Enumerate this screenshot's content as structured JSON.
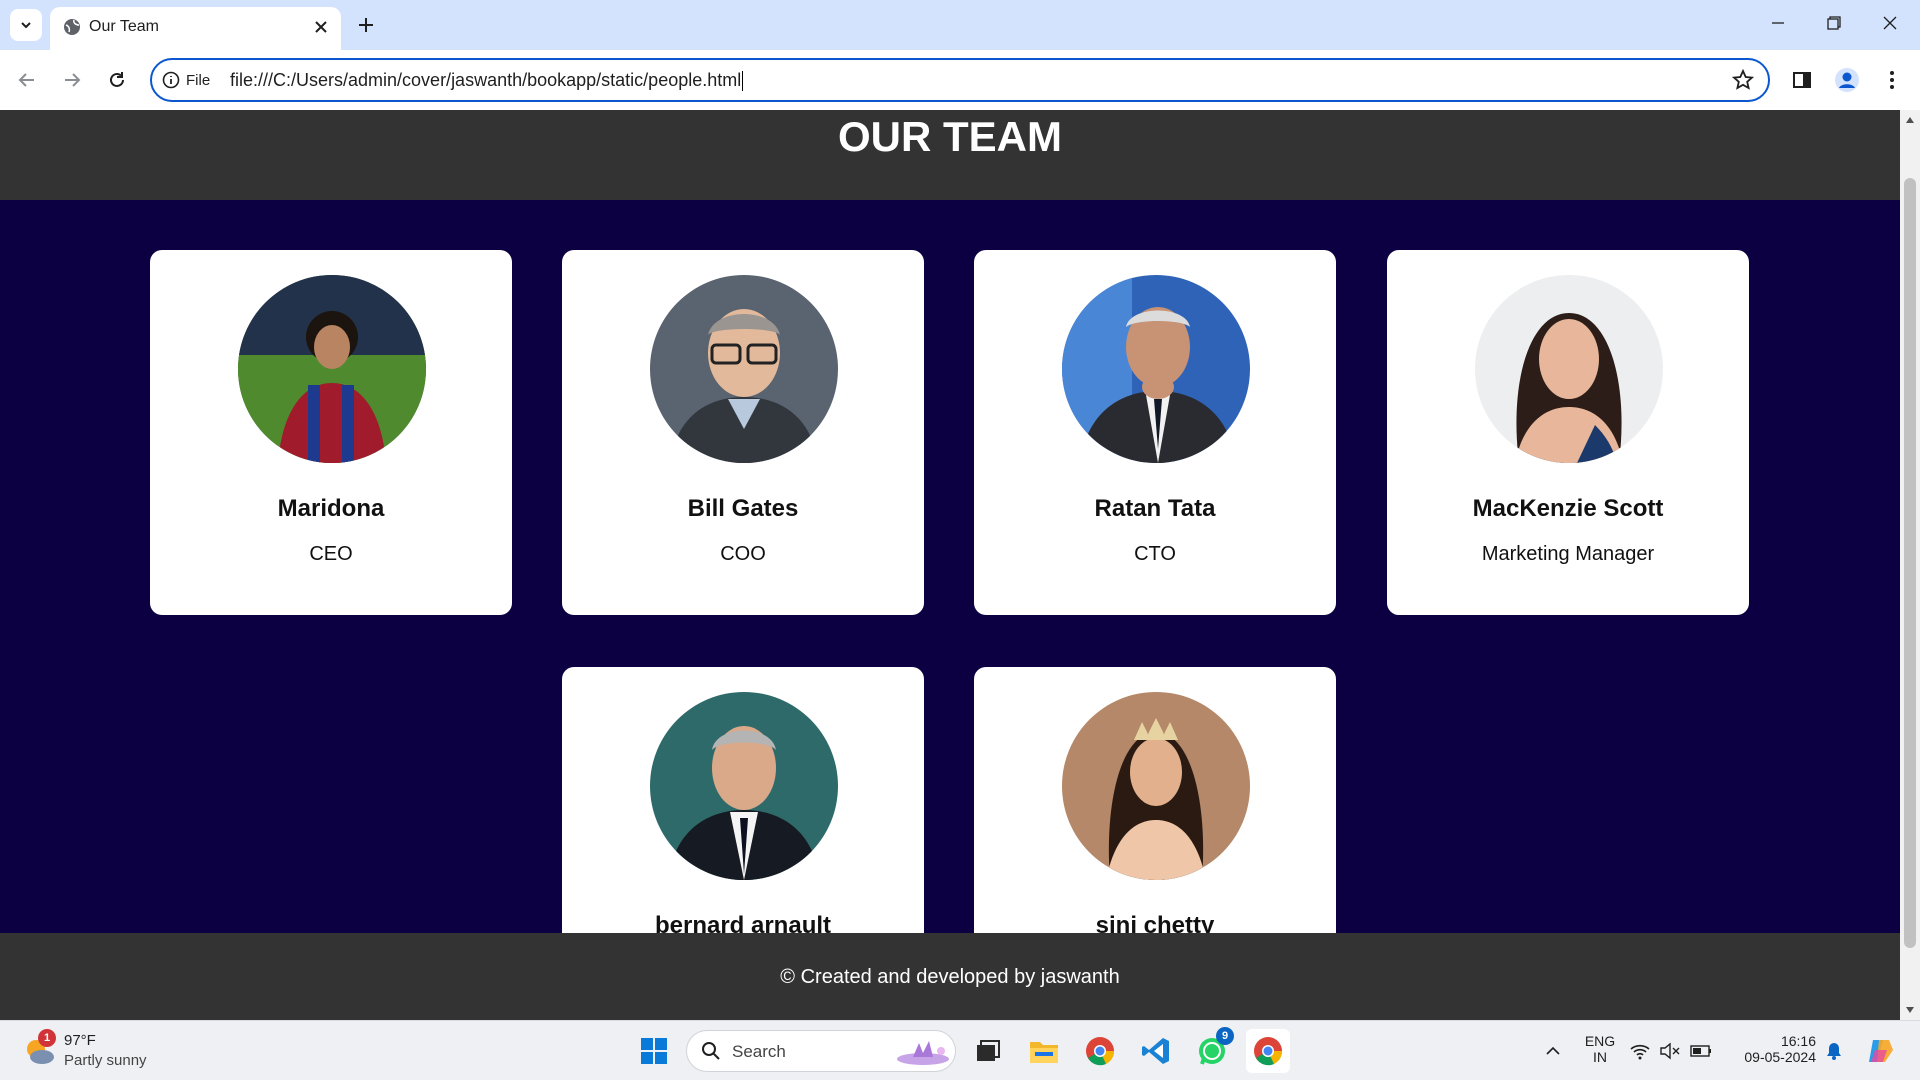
{
  "browser": {
    "tab_title": "Our Team",
    "address_chip": "File",
    "url": "file:///C:/Users/admin/cover/jaswanth/bookapp/static/people.html"
  },
  "page": {
    "title": "OUR TEAM",
    "members": [
      {
        "name": "Maridona",
        "role": "CEO"
      },
      {
        "name": "Bill Gates",
        "role": "COO"
      },
      {
        "name": "Ratan Tata",
        "role": "CTO"
      },
      {
        "name": "MacKenzie Scott",
        "role": "Marketing Manager"
      },
      {
        "name": "bernard arnault",
        "role": ""
      },
      {
        "name": "sini chetty",
        "role": ""
      }
    ],
    "footer": "© Created and developed by jaswanth"
  },
  "taskbar": {
    "weather_temp": "97°F",
    "weather_condition": "Partly sunny",
    "weather_badge": "1",
    "search_label": "Search",
    "whatsapp_badge": "9",
    "lang_line1": "ENG",
    "lang_line2": "IN",
    "time": "16:16",
    "date": "09-05-2024"
  },
  "colors": {
    "page_bg": "#0c0042",
    "header_bg": "#333333",
    "card_bg": "#ffffff",
    "accent": "#0b57d0"
  }
}
